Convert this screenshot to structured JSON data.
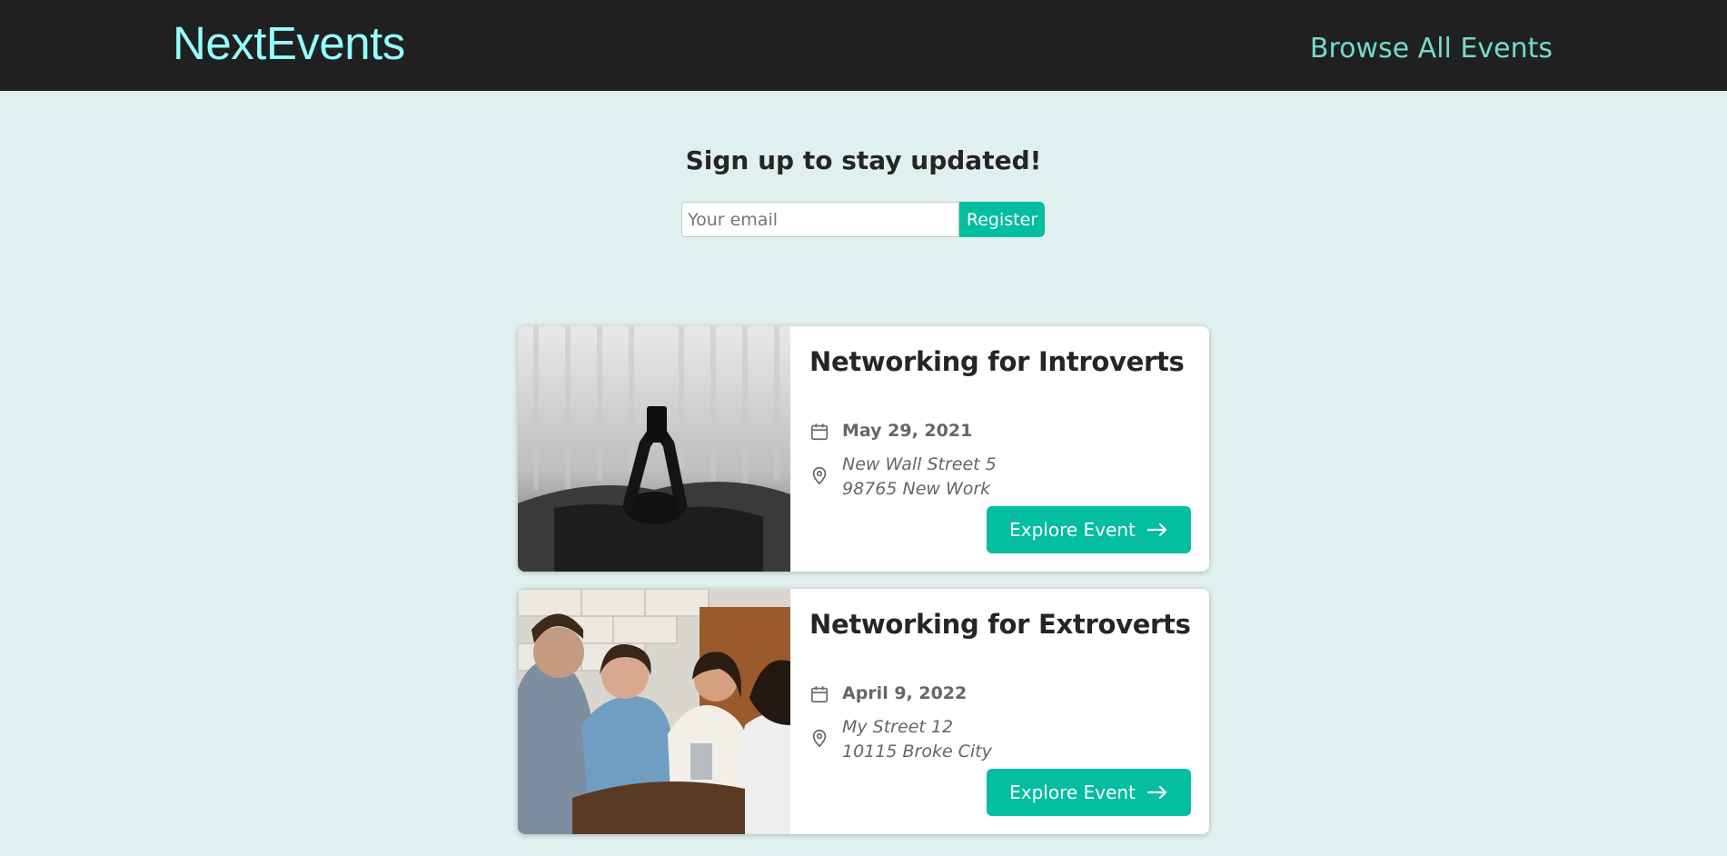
{
  "header": {
    "logo": "NextEvents",
    "nav_link": "Browse All Events"
  },
  "signup": {
    "title": "Sign up to stay updated!",
    "email_placeholder": "Your email",
    "register_label": "Register"
  },
  "events": [
    {
      "title": "Networking for Introverts",
      "date": "May 29, 2021",
      "address_line1": "New Wall Street 5",
      "address_line2": "98765 New Work",
      "button_label": "Explore Event",
      "image_icon": "event-photo-person-phone"
    },
    {
      "title": "Networking for Extroverts",
      "date": "April 9, 2022",
      "address_line1": "My Street 12",
      "address_line2": "10115 Broke City",
      "button_label": "Explore Event",
      "image_icon": "event-photo-group-laughing"
    }
  ],
  "colors": {
    "header_bg": "#202020",
    "logo": "#94fdfd",
    "nav_link": "#74dacc",
    "page_bg": "#e0f0ef",
    "accent": "#03be9f"
  }
}
